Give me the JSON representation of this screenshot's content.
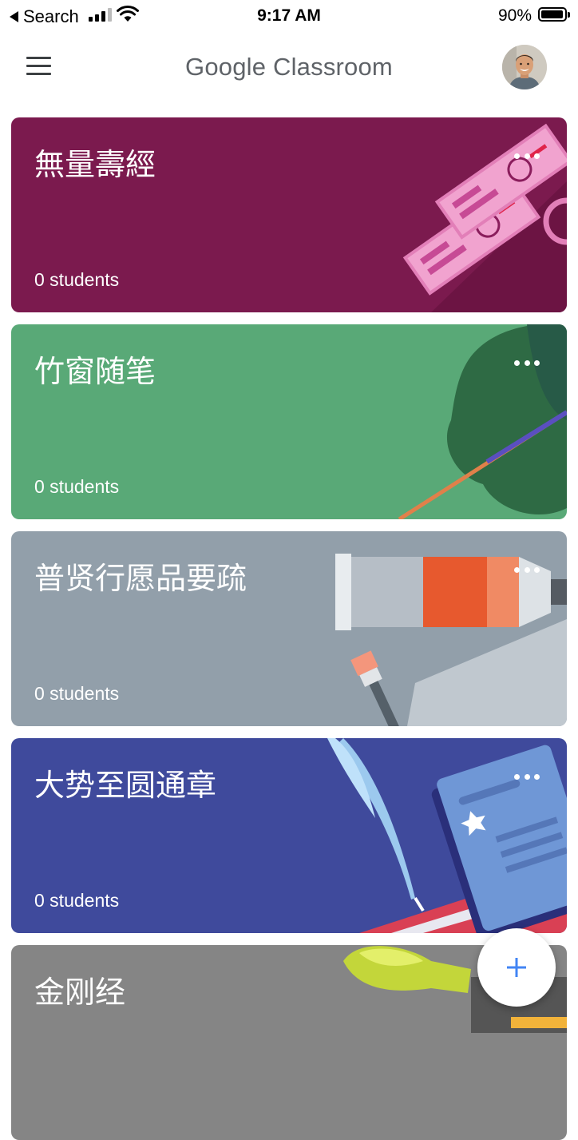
{
  "status_bar": {
    "back_label": "Search",
    "time": "9:17 AM",
    "battery_percent": "90%",
    "battery_level": 0.9
  },
  "app_bar": {
    "title": "Google Classroom",
    "menu_icon": "hamburger-menu-icon",
    "avatar_icon": "user-avatar"
  },
  "colors": {
    "card_1": "#7b1a4e",
    "card_2": "#59a977",
    "card_3": "#929faa",
    "card_4": "#3f4a9c",
    "card_5": "#858585",
    "fab_plus": "#4285f4"
  },
  "classes": [
    {
      "name": "無量壽經",
      "students": "0 students"
    },
    {
      "name": "竹窗随笔",
      "students": "0 students"
    },
    {
      "name": "普贤行愿品要疏",
      "students": "0 students"
    },
    {
      "name": "大势至圆通章",
      "students": "0 students"
    },
    {
      "name": "金刚经",
      "students": ""
    }
  ],
  "fab": {
    "icon": "plus-icon"
  }
}
